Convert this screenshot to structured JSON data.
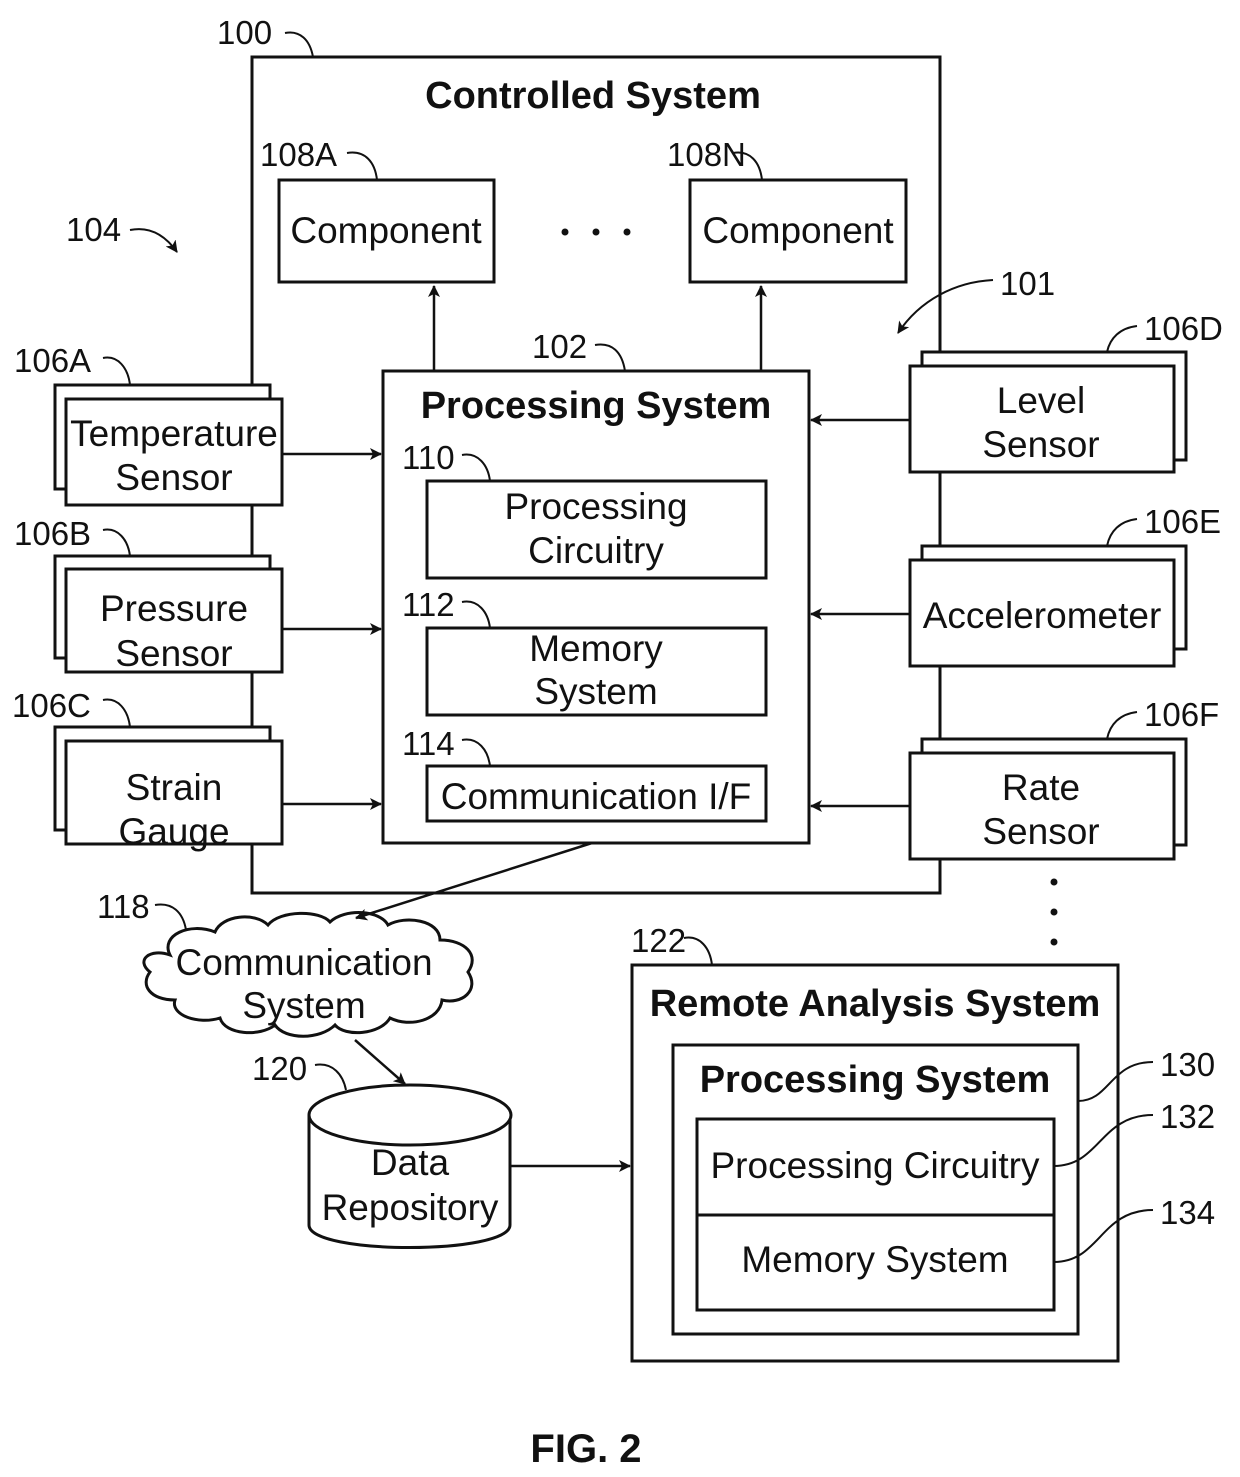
{
  "figure": {
    "caption": "FIG. 2"
  },
  "controlled_system": {
    "ref": "100",
    "title": "Controlled System",
    "group_ref": "101",
    "components": [
      {
        "ref": "108A",
        "label": "Component"
      },
      {
        "ref": "108N",
        "label": "Component"
      }
    ],
    "processing_system": {
      "ref": "102",
      "title": "Processing System",
      "blocks": [
        {
          "ref": "110",
          "lines": [
            "Processing",
            "Circuitry"
          ]
        },
        {
          "ref": "112",
          "lines": [
            "Memory",
            "System"
          ]
        },
        {
          "ref": "114",
          "lines": [
            "Communication I/F"
          ]
        }
      ]
    }
  },
  "sensor_group_ref": "104",
  "sensors_left": [
    {
      "ref": "106A",
      "lines": [
        "Temperature",
        "Sensor"
      ]
    },
    {
      "ref": "106B",
      "lines": [
        "Pressure",
        "Sensor"
      ]
    },
    {
      "ref": "106C",
      "lines": [
        "Strain",
        "Gauge"
      ]
    }
  ],
  "sensors_right": [
    {
      "ref": "106D",
      "lines": [
        "Level",
        "Sensor"
      ]
    },
    {
      "ref": "106E",
      "lines": [
        "Accelerometer"
      ]
    },
    {
      "ref": "106F",
      "lines": [
        "Rate",
        "Sensor"
      ]
    }
  ],
  "communication_system": {
    "ref": "118",
    "lines": [
      "Communication",
      "System"
    ]
  },
  "data_repository": {
    "ref": "120",
    "lines": [
      "Data",
      "Repository"
    ]
  },
  "remote_analysis_system": {
    "ref": "122",
    "title": "Remote Analysis System",
    "processing_system": {
      "ref": "130",
      "title": "Processing System",
      "blocks": [
        {
          "ref": "132",
          "label": "Processing Circuitry"
        },
        {
          "ref": "134",
          "label": "Memory System"
        }
      ]
    }
  }
}
